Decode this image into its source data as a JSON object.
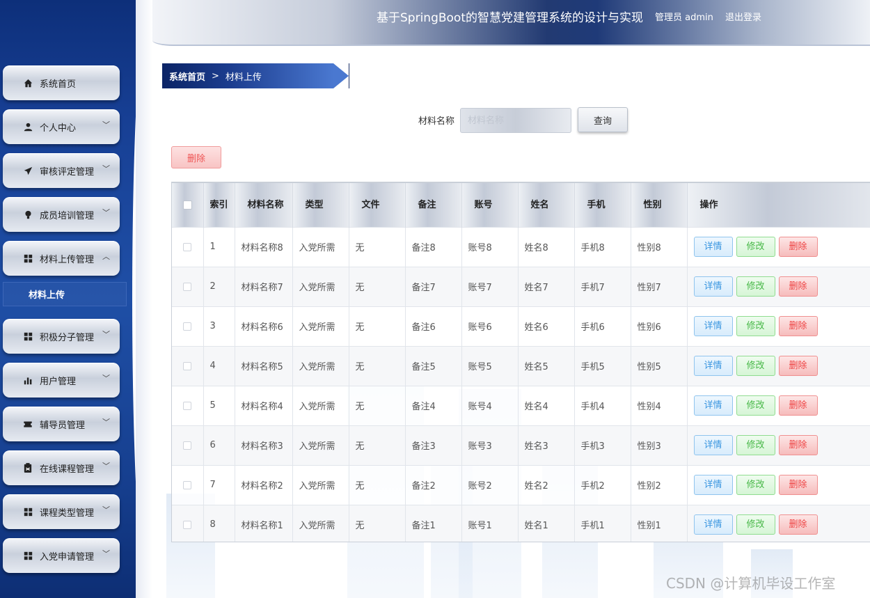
{
  "header": {
    "title": "基于SpringBoot的智慧党建管理系统的设计与实现",
    "user": "管理员 admin",
    "logout": "退出登录"
  },
  "sidebar": {
    "items": [
      {
        "label": "系统首页",
        "icon": "home-icon",
        "arrow": ""
      },
      {
        "label": "个人中心",
        "icon": "user-icon",
        "arrow": "﹀"
      },
      {
        "label": "审核评定管理",
        "icon": "paper-plane-icon",
        "arrow": "﹀"
      },
      {
        "label": "成员培训管理",
        "icon": "lightbulb-icon",
        "arrow": "﹀"
      },
      {
        "label": "材料上传管理",
        "icon": "grid-icon",
        "arrow": "︿"
      },
      {
        "label": "积极分子管理",
        "icon": "grid-icon",
        "arrow": "﹀"
      },
      {
        "label": "用户管理",
        "icon": "bar-chart-icon",
        "arrow": "﹀"
      },
      {
        "label": "辅导员管理",
        "icon": "ticket-icon",
        "arrow": "﹀"
      },
      {
        "label": "在线课程管理",
        "icon": "clipboard-icon",
        "arrow": "﹀"
      },
      {
        "label": "课程类型管理",
        "icon": "grid-icon",
        "arrow": "﹀"
      },
      {
        "label": "入党申请管理",
        "icon": "grid-icon",
        "arrow": "﹀"
      }
    ],
    "active_sub": "材料上传"
  },
  "breadcrumb": {
    "home": "系统首页",
    "separator": ">",
    "current": "材料上传"
  },
  "search": {
    "label": "材料名称",
    "placeholder": "材料名称",
    "button": "查询"
  },
  "toolbar": {
    "delete": "删除"
  },
  "table": {
    "headers": {
      "index": "索引",
      "name": "材料名称",
      "type": "类型",
      "file": "文件",
      "note": "备注",
      "account": "账号",
      "person": "姓名",
      "phone": "手机",
      "gender": "性别",
      "actions": "操作"
    },
    "action_labels": {
      "detail": "详情",
      "edit": "修改",
      "delete": "删除"
    },
    "rows": [
      {
        "index": "1",
        "name": "材料名称8",
        "type": "入党所需",
        "file": "无",
        "note": "备注8",
        "account": "账号8",
        "person": "姓名8",
        "phone": "手机8",
        "gender": "性别8"
      },
      {
        "index": "2",
        "name": "材料名称7",
        "type": "入党所需",
        "file": "无",
        "note": "备注7",
        "account": "账号7",
        "person": "姓名7",
        "phone": "手机7",
        "gender": "性别7"
      },
      {
        "index": "3",
        "name": "材料名称6",
        "type": "入党所需",
        "file": "无",
        "note": "备注6",
        "account": "账号6",
        "person": "姓名6",
        "phone": "手机6",
        "gender": "性别6"
      },
      {
        "index": "4",
        "name": "材料名称5",
        "type": "入党所需",
        "file": "无",
        "note": "备注5",
        "account": "账号5",
        "person": "姓名5",
        "phone": "手机5",
        "gender": "性别5"
      },
      {
        "index": "5",
        "name": "材料名称4",
        "type": "入党所需",
        "file": "无",
        "note": "备注4",
        "account": "账号4",
        "person": "姓名4",
        "phone": "手机4",
        "gender": "性别4"
      },
      {
        "index": "6",
        "name": "材料名称3",
        "type": "入党所需",
        "file": "无",
        "note": "备注3",
        "account": "账号3",
        "person": "姓名3",
        "phone": "手机3",
        "gender": "性别3"
      },
      {
        "index": "7",
        "name": "材料名称2",
        "type": "入党所需",
        "file": "无",
        "note": "备注2",
        "account": "账号2",
        "person": "姓名2",
        "phone": "手机2",
        "gender": "性别2"
      },
      {
        "index": "8",
        "name": "材料名称1",
        "type": "入党所需",
        "file": "无",
        "note": "备注1",
        "account": "账号1",
        "person": "姓名1",
        "phone": "手机1",
        "gender": "性别1"
      }
    ]
  },
  "watermark": "CSDN @计算机毕设工作室"
}
